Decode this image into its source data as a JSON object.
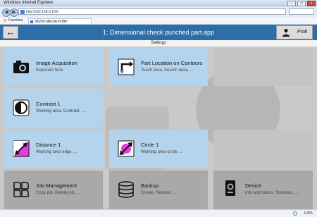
{
  "browser": {
    "window_title": "Windows Internet Explorer",
    "address": "http://192.168.0.100/",
    "favorites_label": "Favorites",
    "tab_label": "XF200 MEDIA FOBP",
    "zoom": "100%"
  },
  "header": {
    "back_glyph": "←",
    "title": "1:  Dimensional check punched part.app",
    "profi_label": "Profi"
  },
  "subheader": {
    "label": "Settings"
  },
  "tiles": [
    {
      "title": "Image Acquisition",
      "subtitle": "Exposure time",
      "icon": "camera-icon"
    },
    {
      "title": "Part Location on Contours",
      "subtitle": "Teach area, Search area, ...",
      "icon": "part-location-icon"
    },
    {
      "title": "Contrast 1",
      "subtitle": "Working area, Contrast, ...",
      "icon": "contrast-icon"
    },
    {
      "title": "Distance 1",
      "subtitle": "Working area edge, ...",
      "icon": "distance-icon"
    },
    {
      "title": "Circle 1",
      "subtitle": "Working area circle, ...",
      "icon": "circle-icon"
    },
    {
      "title": "Job Management",
      "subtitle": "Copy job, Delete job, ...",
      "icon": "job-management-icon"
    },
    {
      "title": "Backup",
      "subtitle": "Create, Restore, ...",
      "icon": "backup-icon"
    },
    {
      "title": "Device",
      "subtitle": "Info and status, Statistics, ...",
      "icon": "device-icon"
    }
  ],
  "colors": {
    "header_blue": "#2e6ea8",
    "tile_blue": "#b3d4ec",
    "tile_grey": "#a9a9a9",
    "accent_magenta": "#e83adf"
  }
}
